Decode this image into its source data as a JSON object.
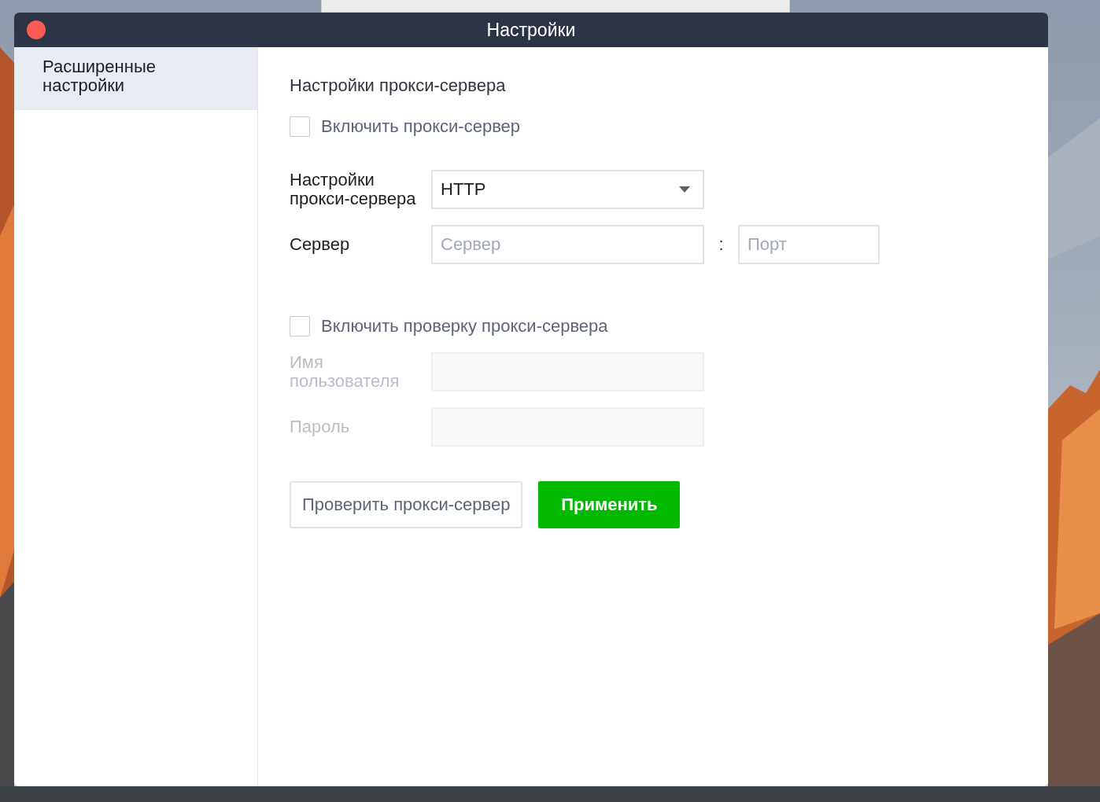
{
  "window": {
    "title": "Настройки"
  },
  "sidebar": {
    "items": [
      {
        "label": "Расширенные настройки",
        "selected": true
      }
    ]
  },
  "section_title": "Настройки прокси-сервера",
  "enable_proxy": {
    "label": "Включить прокси-сервер",
    "checked": false
  },
  "proxy_type": {
    "label": "Настройки прокси-сервера",
    "value": "HTTP"
  },
  "server": {
    "label": "Сервер",
    "placeholder": "Сервер",
    "separator": ":",
    "port_placeholder": "Порт"
  },
  "enable_auth": {
    "label": "Включить проверку прокси-сервера",
    "checked": false
  },
  "username": {
    "label": "Имя пользователя",
    "disabled": true
  },
  "password": {
    "label": "Пароль",
    "disabled": true
  },
  "buttons": [
    {
      "label": "Проверить прокси-сервер",
      "kind": "secondary"
    },
    {
      "label": "Применить",
      "kind": "primary"
    }
  ]
}
